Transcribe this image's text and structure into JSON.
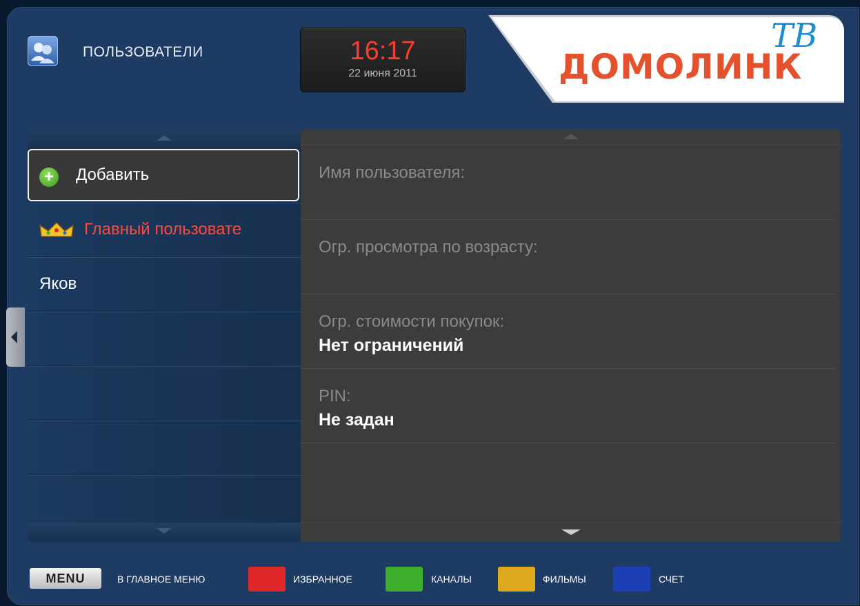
{
  "header": {
    "title": "ПОЛЬЗОВАТЕЛИ",
    "icon": "users-icon",
    "clock": {
      "time": "16:17",
      "date": "22 июня 2011"
    },
    "logo": {
      "text": "ДОМОЛИНК",
      "tv": "ТВ"
    }
  },
  "users": {
    "items": [
      {
        "label": "Добавить",
        "icon": "plus-icon",
        "selected": true
      },
      {
        "label": "Главный пользовате",
        "icon": "crown-icon"
      },
      {
        "label": "Яков"
      },
      {
        "label": ""
      },
      {
        "label": ""
      },
      {
        "label": ""
      },
      {
        "label": ""
      }
    ]
  },
  "details": {
    "username_label": "Имя пользователя:",
    "age_label": "Огр. просмотра по возрасту:",
    "purchase_label": "Огр. стоимости покупок:",
    "purchase_value": "Нет ограничений",
    "pin_label": "PIN:",
    "pin_value": "Не задан"
  },
  "footer": {
    "menu_label": "MENU",
    "main_menu": "В ГЛАВНОЕ МЕНЮ",
    "favorites": "ИЗБРАННОЕ",
    "channels": "КАНАЛЫ",
    "movies": "ФИЛЬМЫ",
    "account": "СЧЕТ",
    "colors": {
      "red": "#e0282b",
      "green": "#3cae2b",
      "yellow": "#e0a81c",
      "blue": "#1d3fb5"
    }
  }
}
